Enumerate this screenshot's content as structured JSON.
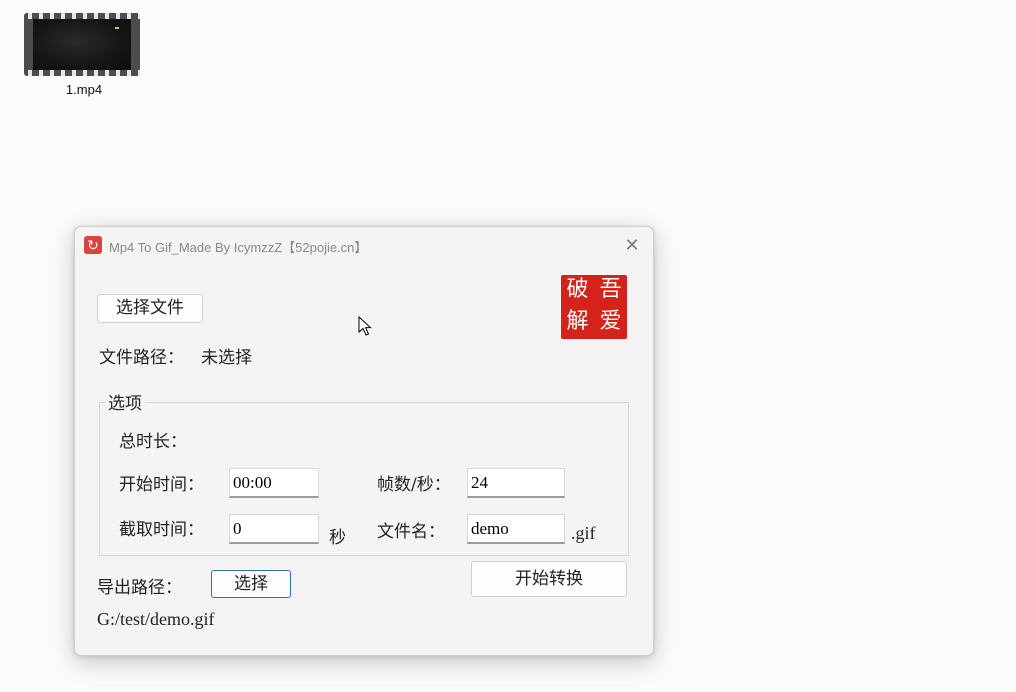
{
  "desktop": {
    "file_label": "1.mp4",
    "file_icon": "video-file-icon"
  },
  "window": {
    "title": "Mp4 To Gif_Made By IcymzzZ【52pojie.cn】",
    "app_icon": "refresh-icon",
    "close_glyph": "✕",
    "select_file_button": "选择文件",
    "file_path_label": "文件路径：",
    "file_path_value": "未选择",
    "logo_chars": [
      "破",
      "吾",
      "解",
      "爱"
    ],
    "options": {
      "title": "选项",
      "total_duration_label": "总时长：",
      "start_time_label": "开始时间：",
      "start_time_value": "00:00",
      "fps_label": "帧数/秒：",
      "fps_value": "24",
      "clip_time_label": "截取时间：",
      "clip_time_value": "0",
      "clip_time_unit": "秒",
      "filename_label": "文件名：",
      "filename_value": "demo",
      "filename_ext": ".gif"
    },
    "export_path_label": "导出路径：",
    "export_select_button": "选择",
    "start_convert_button": "开始转换",
    "export_path_value": "G:/test/demo.gif"
  },
  "colors": {
    "seal_red": "#d5231c",
    "focus_border": "#2a6fb5",
    "app_icon_red": "#d9433b"
  }
}
